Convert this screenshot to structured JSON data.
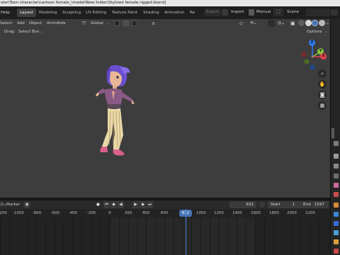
{
  "window": {
    "title_path": "ster\\Toon character\\cartoon female_\\model\\New folder\\Stylized female rigged.blend]"
  },
  "topbar": {
    "menu": [
      {
        "label": "Help"
      }
    ],
    "workspace_tabs": [
      {
        "label": "Layout",
        "active": true
      },
      {
        "label": "Modeling"
      },
      {
        "label": "Sculpting"
      },
      {
        "label": "UV Editing"
      },
      {
        "label": "Texture Paint"
      },
      {
        "label": "Shading"
      },
      {
        "label": "Animation"
      },
      {
        "label": "Re"
      }
    ],
    "export_label": "Export",
    "import_label": "Import",
    "manual_label": "Manual",
    "scene_label": "Scene"
  },
  "viewport_header": {
    "menu": [
      {
        "label": "Select"
      },
      {
        "label": "Add"
      },
      {
        "label": "Object"
      },
      {
        "label": "AnimAide"
      }
    ],
    "transform_orientation": "Global",
    "drag_label": "Drag:",
    "drag_value": "Select Box",
    "options_label": "Options"
  },
  "nav_gizmo": {
    "axes": [
      {
        "label": "Z",
        "color": "#2f7cf5"
      },
      {
        "label": "Y",
        "color": "#89c23c"
      },
      {
        "label": "X",
        "color": "#e8424a"
      }
    ]
  },
  "timeline": {
    "marker_label": "Marker",
    "current_frame": "832",
    "start_label": "Start",
    "start_value": "1",
    "end_label": "End",
    "end_value": "1597",
    "playhead_label": "832",
    "header_ticks": [
      "0",
      "200",
      "400",
      "600",
      "1000",
      "1200",
      "1400",
      "1600",
      "1800",
      "2000",
      "2200"
    ],
    "ruler_ticks": [
      "-1200",
      "-1000",
      "-800",
      "-600",
      "-400",
      "-200",
      "0",
      "200",
      "400",
      "600",
      "1000",
      "1200",
      "1400",
      "1600",
      "1800",
      "2000",
      "2200"
    ]
  },
  "colors": {
    "accent": "#4772b3",
    "playhead": "#4a7fd4",
    "axis_x": "#e8424a",
    "axis_y": "#89c23c",
    "axis_z": "#2f7cf5"
  }
}
